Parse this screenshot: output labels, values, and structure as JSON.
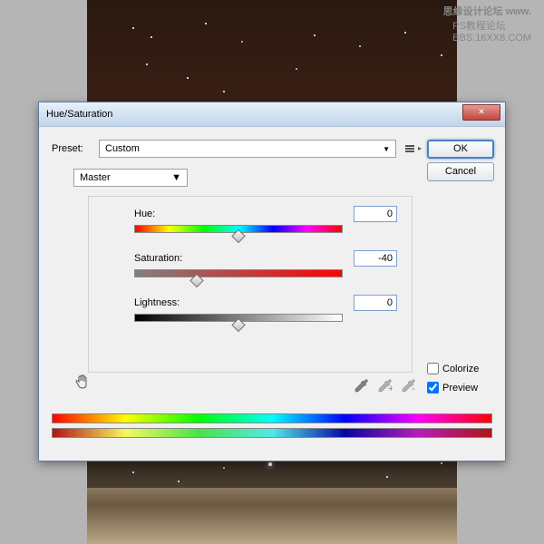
{
  "watermark": {
    "top_line1": "思缘设计论坛",
    "top_line2": "www.",
    "bottom_line1": "PS教程论坛",
    "bottom_line2": "BBS.16XX8.COM"
  },
  "dialog": {
    "title": "Hue/Saturation",
    "close": "✕",
    "preset_label": "Preset:",
    "preset_value": "Custom",
    "channel_value": "Master",
    "hue_label": "Hue:",
    "hue_value": "0",
    "sat_label": "Saturation:",
    "sat_value": "-40",
    "light_label": "Lightness:",
    "light_value": "0",
    "ok": "OK",
    "cancel": "Cancel",
    "colorize": "Colorize",
    "preview": "Preview"
  }
}
